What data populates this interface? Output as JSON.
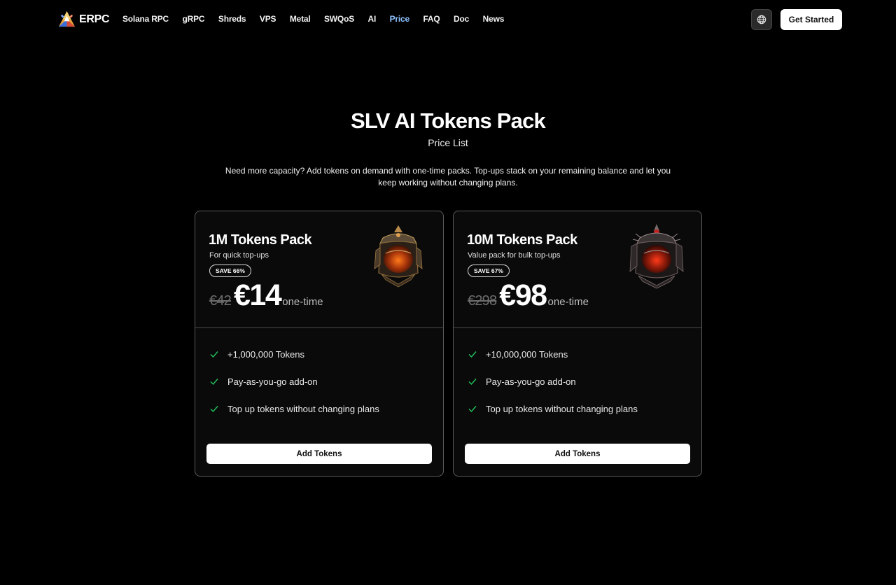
{
  "header": {
    "brand": "ERPC",
    "nav": [
      {
        "label": "Solana RPC"
      },
      {
        "label": "gRPC"
      },
      {
        "label": "Shreds"
      },
      {
        "label": "VPS"
      },
      {
        "label": "Metal"
      },
      {
        "label": "SWQoS"
      },
      {
        "label": "AI"
      },
      {
        "label": "Price",
        "active": true
      },
      {
        "label": "FAQ"
      },
      {
        "label": "Doc"
      },
      {
        "label": "News"
      }
    ],
    "language_icon": "globe-icon",
    "cta_label": "Get Started"
  },
  "hero": {
    "title": "SLV AI Tokens Pack",
    "subtitle": "Price List",
    "description": "Need more capacity? Add tokens on demand with one-time packs. Top-ups stack on your remaining balance and let you keep working without changing plans."
  },
  "plans": [
    {
      "title": "1M Tokens Pack",
      "subtitle": "For quick top-ups",
      "badge": "SAVE 66%",
      "old_price": "€42",
      "price": "€14",
      "period": "one-time",
      "features": [
        "+1,000,000 Tokens",
        "Pay-as-you-go add-on",
        "Top up tokens without changing plans"
      ],
      "button": "Add Tokens"
    },
    {
      "title": "10M Tokens Pack",
      "subtitle": "Value pack for bulk top-ups",
      "badge": "SAVE 67%",
      "old_price": "€298",
      "price": "€98",
      "period": "one-time",
      "features": [
        "+10,000,000 Tokens",
        "Pay-as-you-go add-on",
        "Top up tokens without changing plans"
      ],
      "button": "Add Tokens"
    }
  ],
  "colors": {
    "background": "#000000",
    "accent_nav": "#8ec2ff",
    "check": "#22c55e"
  }
}
